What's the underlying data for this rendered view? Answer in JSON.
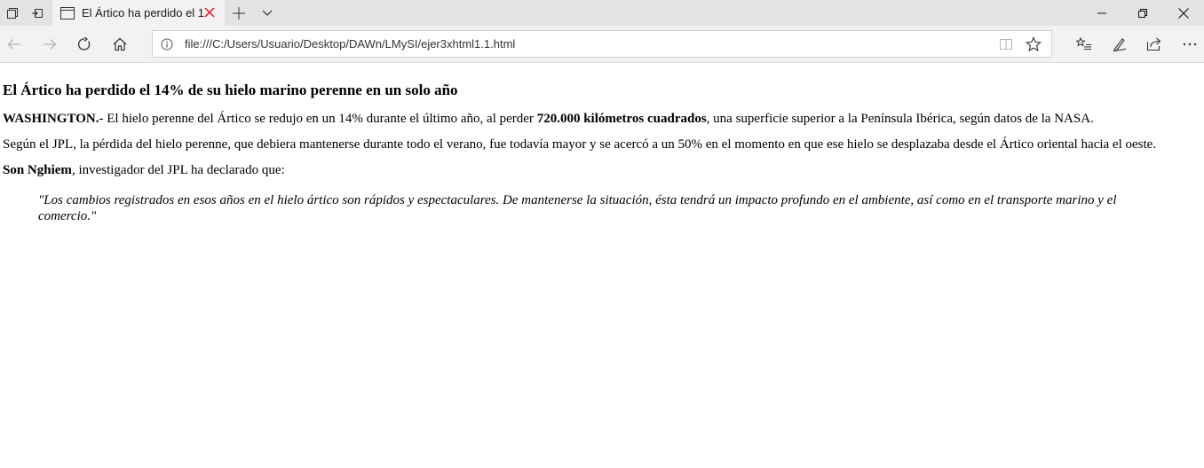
{
  "browser": {
    "tab_title": "El Ártico ha perdido el 1",
    "url": "file:///C:/Users/Usuario/Desktop/DAWn/LMySI/ejer3xhtml1.1.html",
    "tab_close_color": "#e81123"
  },
  "article": {
    "title": "El Ártico ha perdido el 14% de su hielo marino perenne en un solo año",
    "p1": {
      "lead": "WASHINGTON.",
      "text_a": "- El hielo perenne del Ártico se redujo en un 14% durante el último año, al perder ",
      "strong": "720.000 kilómetros cuadrados",
      "text_b": ", una superficie superior a la Península Ibérica, según datos de la NASA."
    },
    "p2": "Según el JPL, la pérdida del hielo perenne, que debiera mantenerse durante todo el verano, fue todavía mayor y se acercó a un 50% en el momento en que ese hielo se desplazaba desde el Ártico oriental hacia el oeste.",
    "p3": {
      "name": "Son Nghiem",
      "text": ", investigador del JPL ha declarado que:"
    },
    "quote": "\"Los cambios registrados en esos años en el hielo ártico son rápidos y espectaculares. De mantenerse la situación, ésta tendrá un impacto profundo en el ambiente, así como en el transporte marino y el comercio.\""
  }
}
